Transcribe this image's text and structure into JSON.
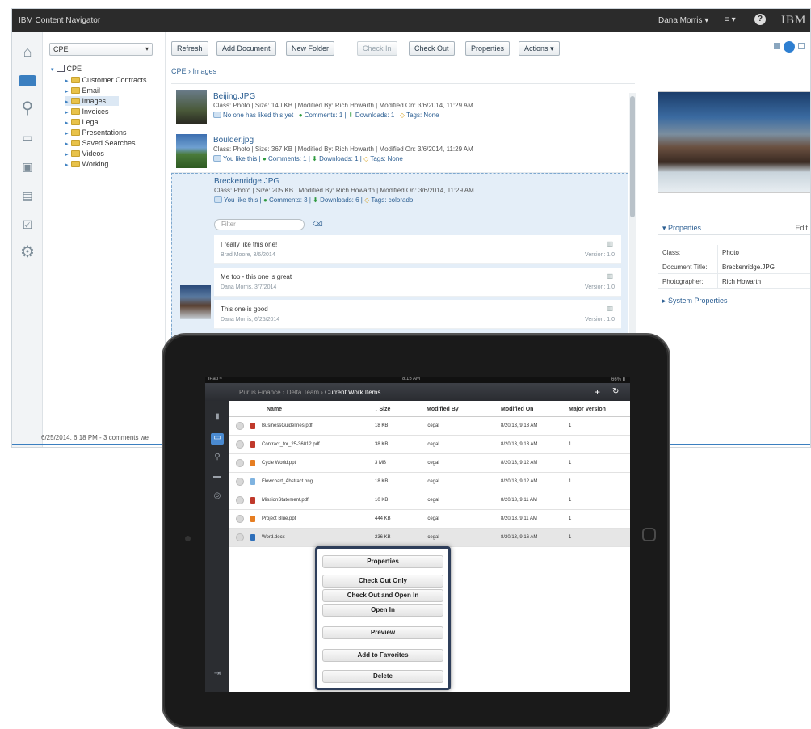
{
  "window": {
    "title": "IBM Content Navigator",
    "user": "Dana Morris ▾",
    "menu_glyph": "≡ ▾",
    "help": "?",
    "brand": "IBM"
  },
  "tree": {
    "repository": "CPE",
    "root": "CPE",
    "folders": [
      "Customer Contracts",
      "Email",
      "Images",
      "Invoices",
      "Legal",
      "Presentations",
      "Saved Searches",
      "Videos",
      "Working"
    ]
  },
  "toolbar": {
    "refresh": "Refresh",
    "add_document": "Add Document",
    "new_folder": "New Folder",
    "check_in": "Check In",
    "check_out": "Check Out",
    "properties": "Properties",
    "actions": "Actions ▾"
  },
  "breadcrumb": "CPE › Images",
  "documents": [
    {
      "name": "Beijing.JPG",
      "meta": "Class: Photo  |  Size: 140 KB  |  Modified By: Rich Howarth  |  Modified On: 3/6/2014, 11:29 AM",
      "like": "No one has liked this yet",
      "comments": "Comments: 1",
      "downloads": "Downloads: 1",
      "tags": "Tags: None"
    },
    {
      "name": "Boulder.jpg",
      "meta": "Class: Photo  |  Size: 367 KB  |  Modified By: Rich Howarth  |  Modified On: 3/6/2014, 11:29 AM",
      "like": "You like this",
      "comments": "Comments: 1",
      "downloads": "Downloads: 1",
      "tags": "Tags: None"
    },
    {
      "name": "Breckenridge.JPG",
      "meta": "Class: Photo  |  Size: 205 KB  |  Modified By: Rich Howarth  |  Modified On: 3/6/2014, 11:29 AM",
      "like": "You like this",
      "comments": "Comments: 3",
      "downloads": "Downloads: 6",
      "tags": "Tags: colorado"
    }
  ],
  "filter_placeholder": "Filter",
  "comments": [
    {
      "text": "I really like this one!",
      "by": "Brad Moore, 3/6/2014",
      "version": "Version: 1.0"
    },
    {
      "text": "Me too - this one is great",
      "by": "Dana Morris, 3/7/2014",
      "version": "Version: 1.0"
    },
    {
      "text": "This one is good",
      "by": "Dana Morris, 6/25/2014",
      "version": "Version: 1.0"
    }
  ],
  "properties": {
    "heading": "▾ Properties",
    "edit": "Edit",
    "rows": [
      {
        "key": "Class:",
        "value": "Photo"
      },
      {
        "key": "Document Title:",
        "value": "Breckenridge.JPG"
      },
      {
        "key": "Photographer:",
        "value": "Rich Howarth"
      }
    ],
    "system": "▸ System Properties"
  },
  "status": "6/25/2014, 6:18 PM - 3 comments we",
  "ipad": {
    "status_left": "iPad ≈",
    "status_time": "8:15 AM",
    "status_right": "66% ▮",
    "breadcrumb_prefix": "Purus Finance  ›  Delta Team  › ",
    "breadcrumb_current": "Current Work Items",
    "add": "+",
    "refresh": "↻",
    "columns": [
      "Name",
      "↓ Size",
      "Modified By",
      "Modified On",
      "Major Version"
    ],
    "rows": [
      {
        "name": "BusinessGuidelines.pdf",
        "size": "18 KB",
        "by": "icegal",
        "on": "8/20/13, 9:13 AM",
        "ver": "1",
        "color": "#c0392b"
      },
      {
        "name": "Contract_for_25-36012.pdf",
        "size": "38 KB",
        "by": "icegal",
        "on": "8/20/13, 9:13 AM",
        "ver": "1",
        "color": "#c0392b"
      },
      {
        "name": "Cycle World.ppt",
        "size": "3 MB",
        "by": "icegal",
        "on": "8/20/13, 9:12 AM",
        "ver": "1",
        "color": "#e67e22"
      },
      {
        "name": "Flowchart_Abstract.png",
        "size": "18 KB",
        "by": "icegal",
        "on": "8/20/13, 9:12 AM",
        "ver": "1",
        "color": "#7fb3e0"
      },
      {
        "name": "MissionStatement.pdf",
        "size": "10 KB",
        "by": "icegal",
        "on": "8/20/13, 9:11 AM",
        "ver": "1",
        "color": "#c0392b"
      },
      {
        "name": "Project Blue.ppt",
        "size": "444 KB",
        "by": "icegal",
        "on": "8/20/13, 9:11 AM",
        "ver": "1",
        "color": "#e67e22"
      },
      {
        "name": "Word.docx",
        "size": "236 KB",
        "by": "icegal",
        "on": "8/20/13, 9:16 AM",
        "ver": "1",
        "color": "#2e6fba"
      }
    ],
    "menu": [
      "Properties",
      "Check Out Only",
      "Check Out and Open In",
      "Open In",
      "Preview",
      "Add to Favorites",
      "Delete"
    ]
  }
}
